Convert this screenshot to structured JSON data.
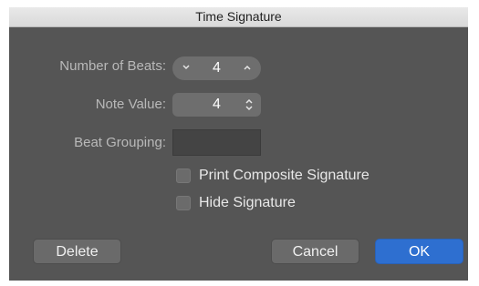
{
  "window": {
    "title": "Time Signature"
  },
  "fields": {
    "beats_label": "Number of Beats:",
    "beats_value": "4",
    "note_label": "Note Value:",
    "note_value": "4",
    "grouping_label": "Beat Grouping:",
    "grouping_value": ""
  },
  "options": {
    "composite_label": "Print Composite Signature",
    "composite_checked": false,
    "hide_label": "Hide Signature",
    "hide_checked": false
  },
  "buttons": {
    "delete": "Delete",
    "cancel": "Cancel",
    "ok": "OK"
  },
  "icons": {
    "decrement": "chevron-down-icon",
    "increment": "chevron-up-icon",
    "popup": "up-down-arrows-icon"
  },
  "colors": {
    "dialog_bg": "#555555",
    "control_bg": "#6e6e6e",
    "accent": "#2e6fd0"
  }
}
